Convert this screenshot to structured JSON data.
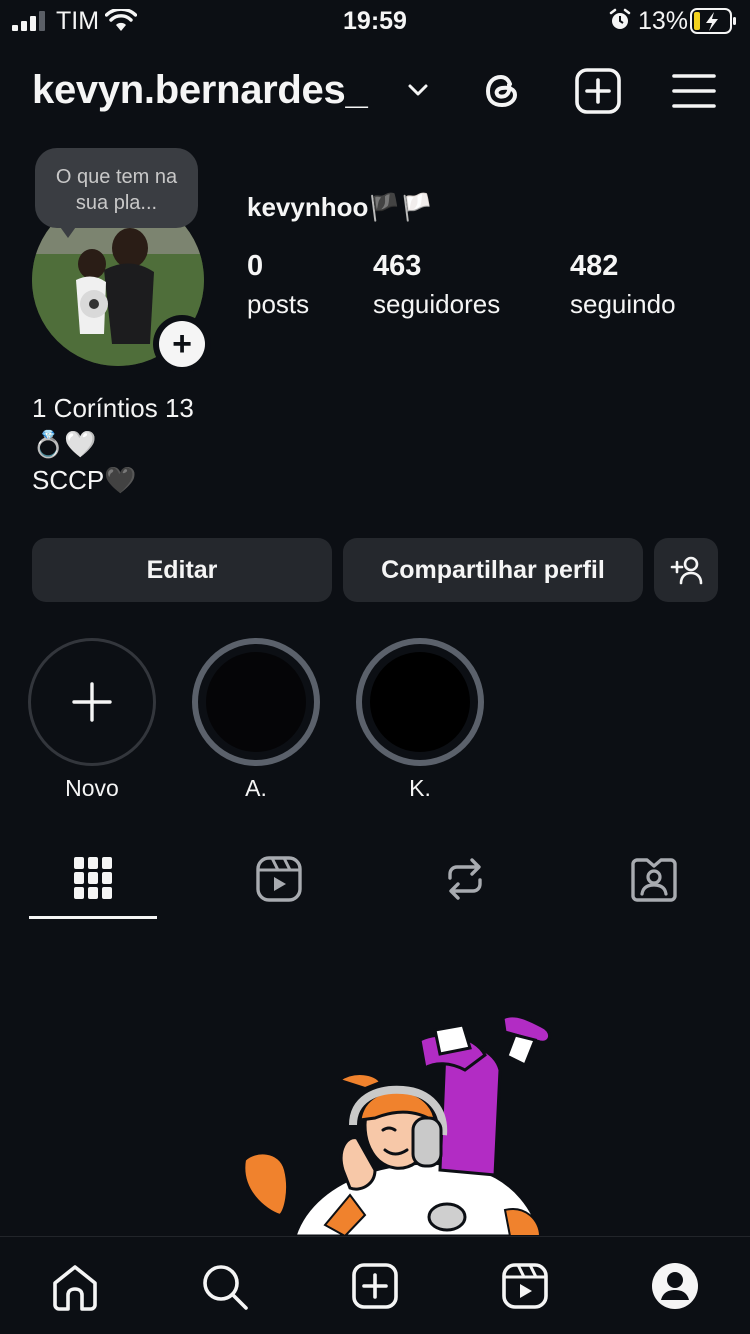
{
  "status_bar": {
    "carrier": "TIM",
    "time": "19:59",
    "battery_percent": "13%"
  },
  "header": {
    "username": "kevyn.bernardes_"
  },
  "profile": {
    "note_bubble": "O que tem na sua pla...",
    "display_name": "kevynhoo🏴🏳️",
    "stats": {
      "posts_count": "0",
      "posts_label": "posts",
      "followers_count": "463",
      "followers_label": "seguidores",
      "following_count": "482",
      "following_label": "seguindo"
    },
    "bio": {
      "line1": "1 Coríntios 13",
      "line2": "💍🤍",
      "line3": "SCCP🖤"
    }
  },
  "actions": {
    "edit_label": "Editar",
    "share_label": "Compartilhar perfil"
  },
  "highlights": [
    {
      "label": "Novo"
    },
    {
      "label": "A."
    },
    {
      "label": "K."
    }
  ],
  "icons": {
    "header": [
      "chevron-down-icon",
      "threads-icon",
      "create-plus-icon",
      "menu-icon"
    ],
    "tabs": [
      "grid-icon",
      "reels-icon",
      "reposts-icon",
      "tagged-icon"
    ],
    "bottom_nav": [
      "home-icon",
      "search-icon",
      "create-icon",
      "reels-icon",
      "profile-icon"
    ]
  },
  "colors": {
    "background": "#0c0f14",
    "button": "#25282d",
    "highlight_ring": "#5b616b",
    "illustration_orange": "#f0822d",
    "illustration_purple": "#b22cc4"
  }
}
